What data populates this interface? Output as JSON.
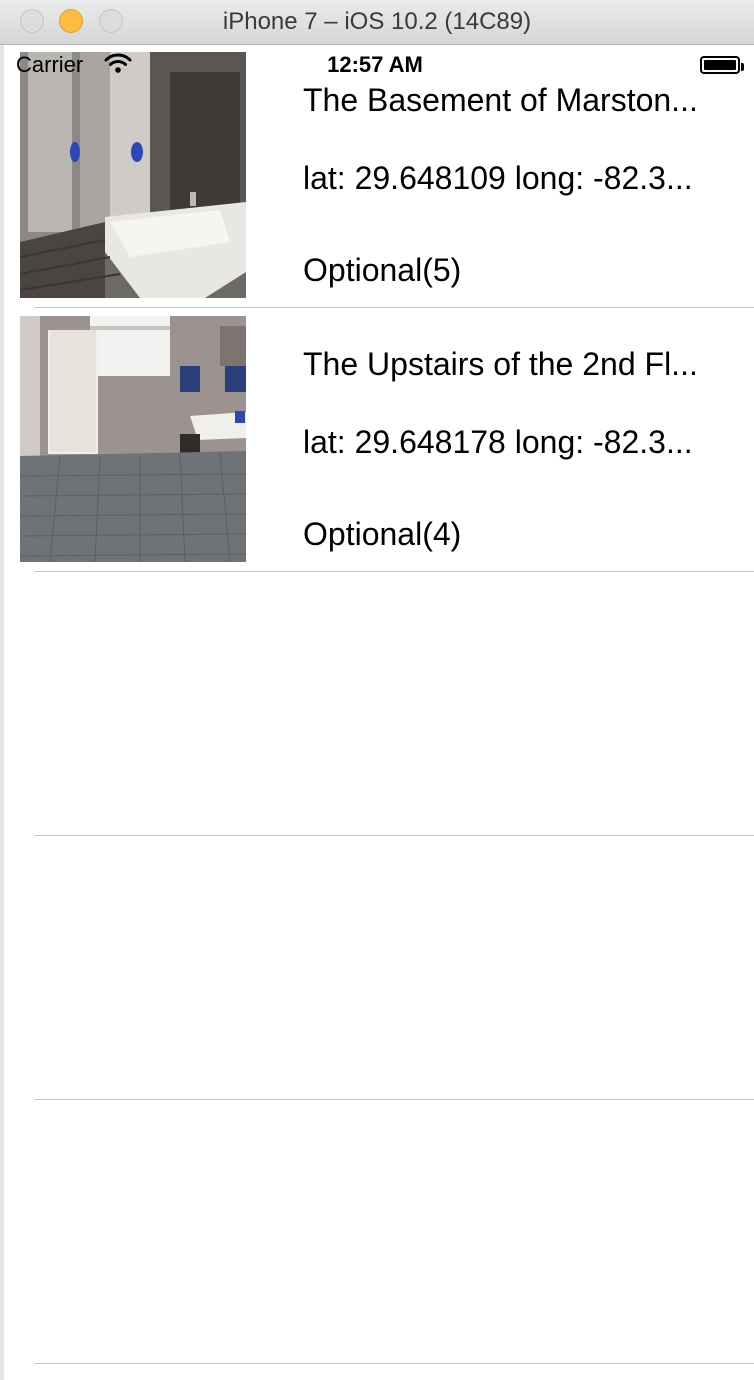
{
  "window": {
    "title": "iPhone 7 – iOS 10.2 (14C89)"
  },
  "status_bar": {
    "carrier": "Carrier",
    "time": "12:57 AM",
    "wifi_icon": "wifi-icon",
    "battery_icon": "battery-icon"
  },
  "table": {
    "rows": [
      {
        "title": "The Basement of Marston...",
        "coords": "lat: 29.648109 long: -82.3...",
        "rating": "Optional(5)",
        "image": "restroom-photo"
      },
      {
        "title": "The Upstairs of the 2nd Fl...",
        "coords": "lat: 29.648178 long: -82.3...",
        "rating": "Optional(4)",
        "image": "restroom-photo"
      }
    ]
  }
}
